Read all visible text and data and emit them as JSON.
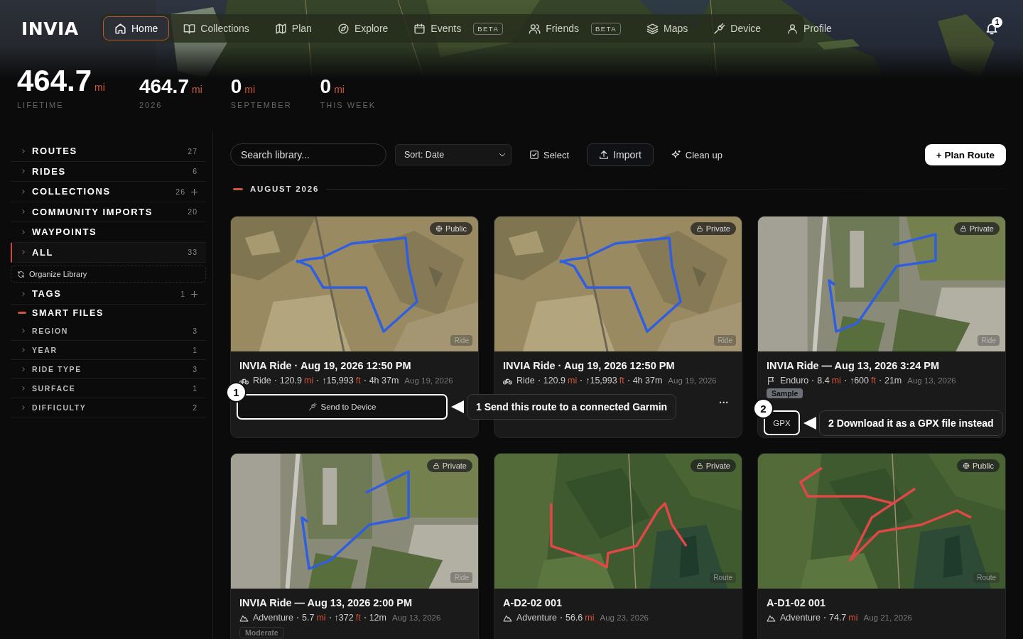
{
  "brand": "INVIA",
  "nav": [
    {
      "label": "Home",
      "selected": true
    },
    {
      "label": "Collections",
      "selected": false
    },
    {
      "label": "Plan",
      "selected": false
    },
    {
      "label": "Explore",
      "selected": false
    },
    {
      "label": "Events",
      "badge": "BETA",
      "selected": false
    },
    {
      "label": "Friends",
      "badge": "BETA",
      "selected": false
    },
    {
      "label": "Maps",
      "selected": false
    },
    {
      "label": "Device",
      "selected": false
    },
    {
      "label": "Profile",
      "selected": false
    }
  ],
  "notifications": {
    "count": "1"
  },
  "stats": [
    {
      "kind": "primary",
      "value": "464.7",
      "unit": "mi",
      "label": "LIFETIME"
    },
    {
      "kind": "secondary",
      "value": "464.7",
      "unit": "mi",
      "label": "2026"
    },
    {
      "kind": "secondary",
      "value": "0",
      "unit": "mi",
      "label": "SEPTEMBER"
    },
    {
      "kind": "secondary",
      "value": "0",
      "unit": "mi",
      "label": "THIS WEEK"
    }
  ],
  "sidebar": {
    "items": [
      {
        "kind": "section",
        "label": "ROUTES",
        "count": "27",
        "selected": false
      },
      {
        "kind": "section",
        "label": "RIDES",
        "count": "6",
        "selected": false
      },
      {
        "kind": "section",
        "label": "COLLECTIONS",
        "count": "26",
        "add": true,
        "selected": false
      },
      {
        "kind": "section",
        "label": "COMMUNITY IMPORTS",
        "count": "20",
        "selected": false
      },
      {
        "kind": "section",
        "label": "WAYPOINTS",
        "selected": false
      },
      {
        "kind": "section",
        "label": "ALL",
        "count": "33",
        "selected": true
      },
      {
        "kind": "action",
        "label": "Organize Library"
      },
      {
        "kind": "section",
        "label": "TAGS",
        "count": "1",
        "add": true,
        "selected": false
      },
      {
        "kind": "heading",
        "label": "SMART FILES"
      },
      {
        "kind": "filter",
        "label": "REGION",
        "count": "3",
        "selected": false
      },
      {
        "kind": "filter",
        "label": "YEAR",
        "count": "1",
        "selected": false
      },
      {
        "kind": "filter",
        "label": "RIDE TYPE",
        "count": "3",
        "selected": false
      },
      {
        "kind": "filter",
        "label": "SURFACE",
        "count": "1",
        "selected": false
      },
      {
        "kind": "filter",
        "label": "DIFFICULTY",
        "count": "2",
        "selected": false
      }
    ]
  },
  "toolbar": {
    "search": {
      "placeholder": "Search library..."
    },
    "sort": {
      "value": "Sort: Date"
    },
    "buttons": [
      {
        "kind": "select",
        "label": "Select"
      },
      {
        "kind": "import",
        "label": "Import"
      },
      {
        "kind": "cleanup",
        "label": "Clean up"
      }
    ],
    "primary": {
      "label": "+ Plan Route"
    }
  },
  "section": {
    "title": "AUGUST 2026"
  },
  "cards": [
    {
      "title": "INVIA Ride · Aug 19, 2026 12:50 PM",
      "color": "#2f5fe0",
      "visibility": "Public",
      "type_badge": "Ride",
      "date": "Aug 19, 2026",
      "meta": [
        {
          "text": "Ride"
        },
        {
          "text": "120.9",
          "unit": "mi"
        },
        {
          "text": "↑15,993",
          "unit": "ft"
        },
        {
          "text": "4h 37m"
        }
      ],
      "actions": [
        {
          "kind": "send",
          "label": "Send to Device",
          "callout": {
            "marker": "1",
            "text": "1 Send this route to a connected Garmin"
          }
        }
      ]
    },
    {
      "title": "INVIA Ride · Aug 19, 2026 12:50 PM",
      "color": "#2f5fe0",
      "visibility": "Private",
      "type_badge": "Ride",
      "date": "Aug 19, 2026",
      "meta": [
        {
          "text": "Ride"
        },
        {
          "text": "120.9",
          "unit": "mi"
        },
        {
          "text": "↑15,993",
          "unit": "ft"
        },
        {
          "text": "4h 37m"
        }
      ],
      "actions": [
        {
          "kind": "more",
          "label": "···"
        }
      ]
    },
    {
      "title": "INVIA Ride — Aug 13, 2026 3:24 PM",
      "color": "#2f5fe0",
      "visibility": "Private",
      "type_badge": "Ride",
      "date": "Aug 13, 2026",
      "tag": {
        "kind": "sample",
        "label": "Sample"
      },
      "meta": [
        {
          "text": "Enduro"
        },
        {
          "text": "8.4",
          "unit": "mi"
        },
        {
          "text": "↑600",
          "unit": "ft"
        },
        {
          "text": "21m"
        }
      ],
      "actions": [
        {
          "kind": "gpx",
          "label": "GPX",
          "callout": {
            "marker": "2",
            "text": "2 Download it as a GPX file instead"
          }
        }
      ]
    },
    {
      "title": "INVIA Ride — Aug 13, 2026 2:00 PM",
      "color": "#2f5fe0",
      "visibility": "Private",
      "type_badge": "Ride",
      "date": "Aug 13, 2026",
      "tag": {
        "kind": "difficulty",
        "label": "Moderate"
      },
      "meta": [
        {
          "text": "Adventure"
        },
        {
          "text": "5.7",
          "unit": "mi"
        },
        {
          "text": "↑372",
          "unit": "ft"
        },
        {
          "text": "12m"
        }
      ]
    },
    {
      "title": "A-D2-02 001",
      "color": "#e04848",
      "visibility": "Private",
      "type_badge": "Route",
      "date": "Aug 23, 2026",
      "meta": [
        {
          "text": "Adventure"
        },
        {
          "text": "56.6",
          "unit": "mi"
        }
      ]
    },
    {
      "title": "A-D1-02 001",
      "color": "#e04848",
      "visibility": "Public",
      "type_badge": "Route",
      "date": "Aug 21, 2026",
      "meta": [
        {
          "text": "Adventure"
        },
        {
          "text": "74.7",
          "unit": "mi"
        }
      ]
    }
  ]
}
